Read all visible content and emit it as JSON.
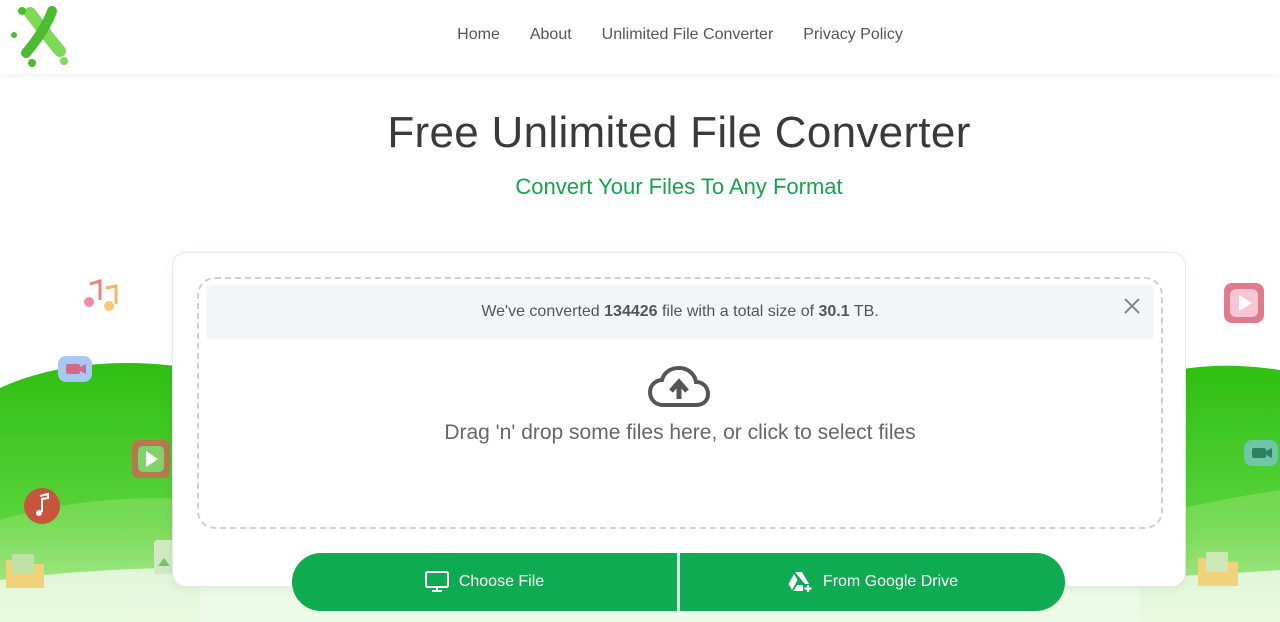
{
  "nav": {
    "items": [
      {
        "label": "Home"
      },
      {
        "label": "About"
      },
      {
        "label": "Unlimited File Converter"
      },
      {
        "label": "Privacy Policy"
      }
    ]
  },
  "hero": {
    "title": "Free Unlimited File Converter",
    "subtitle": "Convert Your Files To Any Format"
  },
  "stats": {
    "prefix": "We've converted ",
    "file_count": "134426",
    "middle": " file with a total size of ",
    "total_size": "30.1",
    "unit": " TB."
  },
  "dropzone": {
    "text": "Drag 'n' drop some files here, or click to select files",
    "icon": "cloud-upload-icon"
  },
  "buttons": {
    "choose_file": "Choose File",
    "google_drive": "From Google Drive"
  },
  "colors": {
    "brand_green": "#0fab52",
    "subtitle_green": "#16a34a",
    "hill_green": "#3cc21e"
  }
}
